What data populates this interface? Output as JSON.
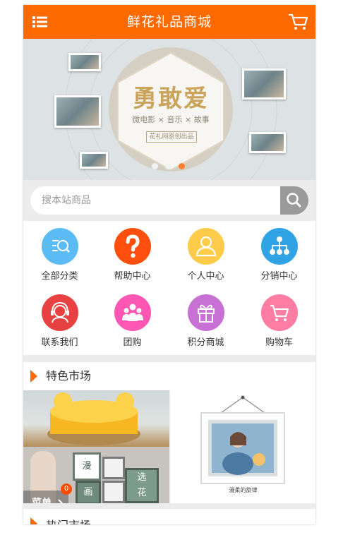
{
  "header": {
    "title": "鲜花礼品商城",
    "menu_icon": "list-icon",
    "cart_icon": "cart-icon"
  },
  "banner": {
    "main_title": "勇敢爱",
    "subtitle": "微电影 × 音乐 × 故事",
    "badge": "花礼网原创出品",
    "dots": 3,
    "active_dot": 3
  },
  "search": {
    "placeholder": "搜本站商品",
    "button_icon": "search-icon"
  },
  "nav": [
    {
      "label": "全部分类",
      "icon": "category-search-icon",
      "color": "#5bbcf5"
    },
    {
      "label": "帮助中心",
      "icon": "question-icon",
      "color": "#ff4e0d"
    },
    {
      "label": "个人中心",
      "icon": "user-icon",
      "color": "#ffcb4a"
    },
    {
      "label": "分销中心",
      "icon": "network-icon",
      "color": "#2fa3e6"
    },
    {
      "label": "联系我们",
      "icon": "headset-icon",
      "color": "#e84141"
    },
    {
      "label": "团购",
      "icon": "group-icon",
      "color": "#ff56b4"
    },
    {
      "label": "积分商城",
      "icon": "gift-icon",
      "color": "#c771d4"
    },
    {
      "label": "购物车",
      "icon": "cart-icon",
      "color": "#ff7ca2"
    }
  ],
  "section": {
    "title": "特色市场"
  },
  "frames_text": {
    "a": "漫",
    "b": "画",
    "c": "选",
    "d": "花"
  },
  "promo_caption": "漫柔的旋律",
  "float_menu": {
    "label": "菜单",
    "count": "0"
  },
  "section2": {
    "title": "热门市场"
  },
  "colors": {
    "accent": "#ff6a00"
  }
}
